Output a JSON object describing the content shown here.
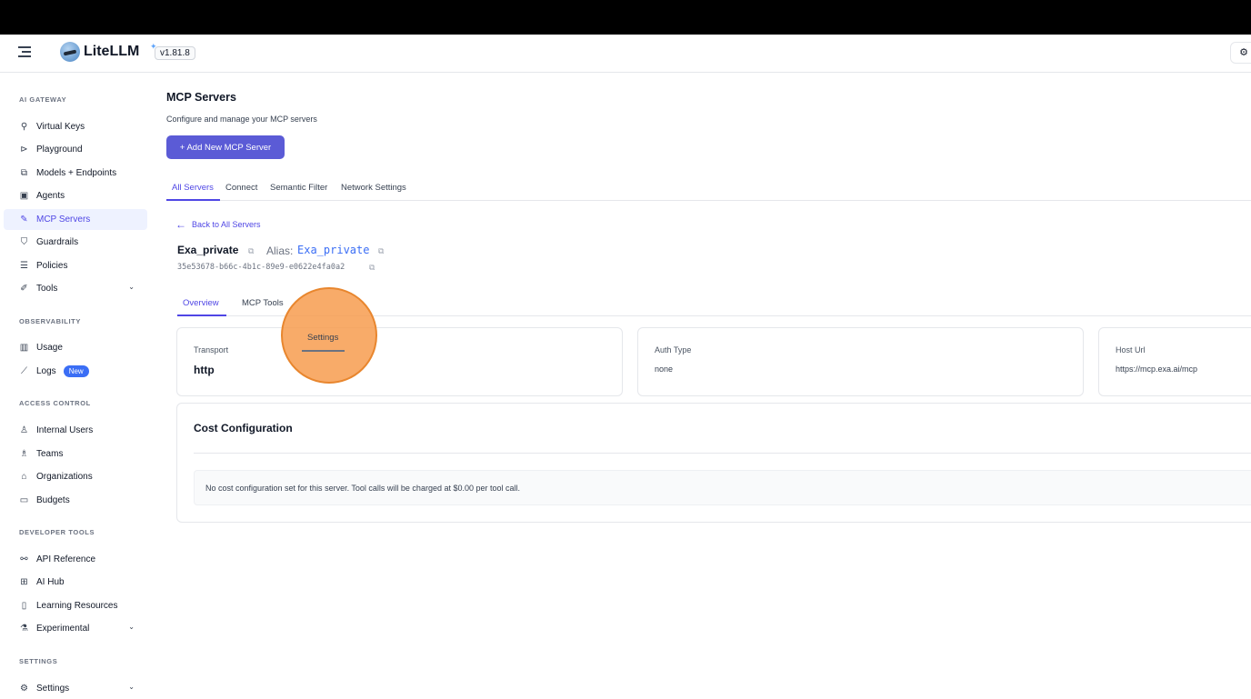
{
  "topbar": {
    "brand": "LiteLLM",
    "version": "v1.81.8",
    "right_icon": "gear-icon"
  },
  "sidebar": {
    "sections": [
      {
        "title": "AI GATEWAY"
      },
      {
        "title": "OBSERVABILITY"
      },
      {
        "title": "ACCESS CONTROL"
      },
      {
        "title": "DEVELOPER TOOLS"
      },
      {
        "title": "SETTINGS"
      }
    ],
    "items": [
      {
        "label": "Virtual Keys",
        "icon": "key-icon"
      },
      {
        "label": "Playground",
        "icon": "play-icon"
      },
      {
        "label": "Models + Endpoints",
        "icon": "models-icon"
      },
      {
        "label": "Agents",
        "icon": "agent-icon"
      },
      {
        "label": "MCP Servers",
        "icon": "tool-icon"
      },
      {
        "label": "Guardrails",
        "icon": "shield-icon"
      },
      {
        "label": "Policies",
        "icon": "policy-icon"
      },
      {
        "label": "Tools",
        "icon": "wrench-icon"
      },
      {
        "label": "Usage",
        "icon": "bar-chart-icon"
      },
      {
        "label": "Logs",
        "icon": "line-chart-icon",
        "badge": "New"
      },
      {
        "label": "Internal Users",
        "icon": "user-icon"
      },
      {
        "label": "Teams",
        "icon": "team-icon"
      },
      {
        "label": "Organizations",
        "icon": "bank-icon"
      },
      {
        "label": "Budgets",
        "icon": "wallet-icon"
      },
      {
        "label": "API Reference",
        "icon": "api-icon"
      },
      {
        "label": "AI Hub",
        "icon": "grid-icon"
      },
      {
        "label": "Learning Resources",
        "icon": "book-icon"
      },
      {
        "label": "Experimental",
        "icon": "flask-icon"
      },
      {
        "label": "Settings",
        "icon": "gear-icon"
      }
    ]
  },
  "main": {
    "title": "MCP Servers",
    "subtitle": "Configure and manage your MCP servers",
    "add_button": "+ Add New MCP Server",
    "tabs": [
      "All Servers",
      "Connect",
      "Semantic Filter",
      "Network Settings"
    ],
    "back_link": "Back to All Servers",
    "server": {
      "name": "Exa_private",
      "alias_label": "Alias:",
      "alias": "Exa_private",
      "id": "35e53678-b66c-4b1c-89e9-e0622e4fa0a2"
    },
    "detail_tabs": [
      "Overview",
      "MCP Tools",
      "Settings"
    ],
    "cards": [
      {
        "label": "Transport",
        "value": "http"
      },
      {
        "label": "Auth Type",
        "value": "none"
      },
      {
        "label": "Host Url",
        "value": "https://mcp.exa.ai/mcp"
      }
    ],
    "cost": {
      "title": "Cost Configuration",
      "note": "No cost configuration set for this server. Tool calls will be charged at $0.00 per tool call."
    }
  },
  "colors": {
    "accent": "#4f46e5",
    "button": "#5b5bd6",
    "click_marker": "#f79848"
  }
}
